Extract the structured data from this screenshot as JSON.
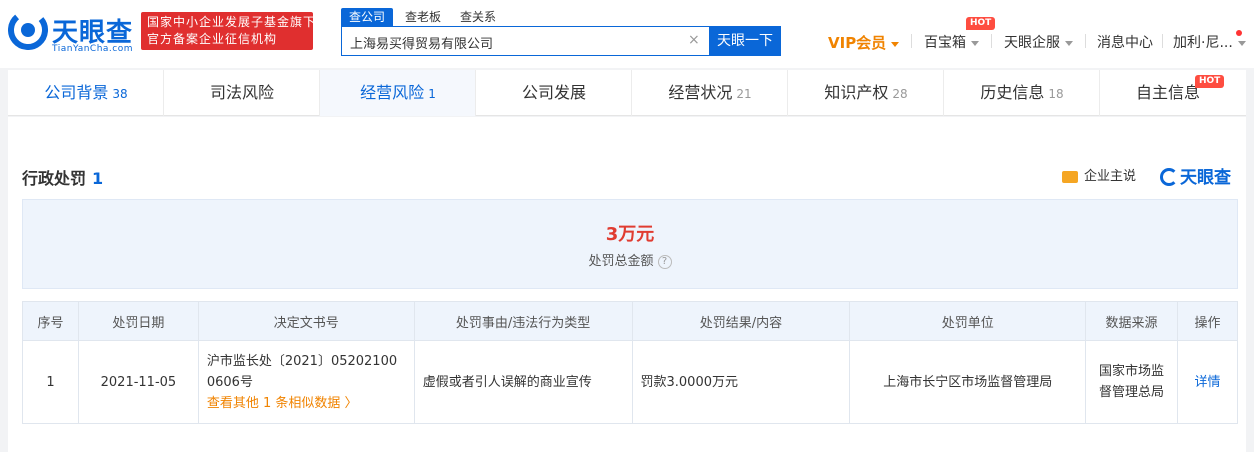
{
  "header": {
    "logo_text": "天眼查",
    "logo_sub": "TianYanCha.com",
    "gov_badge_line1": "国家中小企业发展子基金旗下",
    "gov_badge_line2": "官方备案企业征信机构",
    "search_tabs": [
      "查公司",
      "查老板",
      "查关系"
    ],
    "search_value": "上海易买得贸易有限公司",
    "clear_glyph": "×",
    "search_button": "天眼一下",
    "nav": {
      "vip": "VIP会员",
      "treasure": "百宝箱",
      "hot": "HOT",
      "enterprise": "天眼企服",
      "messages": "消息中心",
      "user": "加利·尼..."
    }
  },
  "tabs": [
    {
      "label": "公司背景",
      "count": "38"
    },
    {
      "label": "司法风险",
      "count": ""
    },
    {
      "label": "经营风险",
      "count": "1"
    },
    {
      "label": "公司发展",
      "count": ""
    },
    {
      "label": "经营状况",
      "count": "21"
    },
    {
      "label": "知识产权",
      "count": "28"
    },
    {
      "label": "历史信息",
      "count": "18"
    },
    {
      "label": "自主信息",
      "count": ""
    }
  ],
  "tab_hot": "HOT",
  "section": {
    "title": "行政处罚",
    "count": "1",
    "promo": "企业主说",
    "brand": "天眼查"
  },
  "summary": {
    "value": "3万元",
    "label": "处罚总金额",
    "help": "?"
  },
  "table": {
    "headers": [
      "序号",
      "处罚日期",
      "决定文书号",
      "处罚事由/违法行为类型",
      "处罚结果/内容",
      "处罚单位",
      "数据来源",
      "操作"
    ],
    "rows": [
      {
        "index": "1",
        "date": "2021-11-05",
        "doc_line1": "沪市监长处〔2021〕05202100",
        "doc_line2": "0606号",
        "similar": "查看其他 1 条相似数据 〉",
        "reason": "虚假或者引人误解的商业宣传",
        "result": "罚款3.0000万元",
        "unit": "上海市长宁区市场监督管理局",
        "source_line1": "国家市场监",
        "source_line2": "督管理总局",
        "action": "详情"
      }
    ]
  },
  "colors": {
    "brand_blue": "#0a67d8",
    "badge_red": "#e02f2f",
    "vip_orange": "#f08300",
    "amount_red": "#e03c31"
  }
}
